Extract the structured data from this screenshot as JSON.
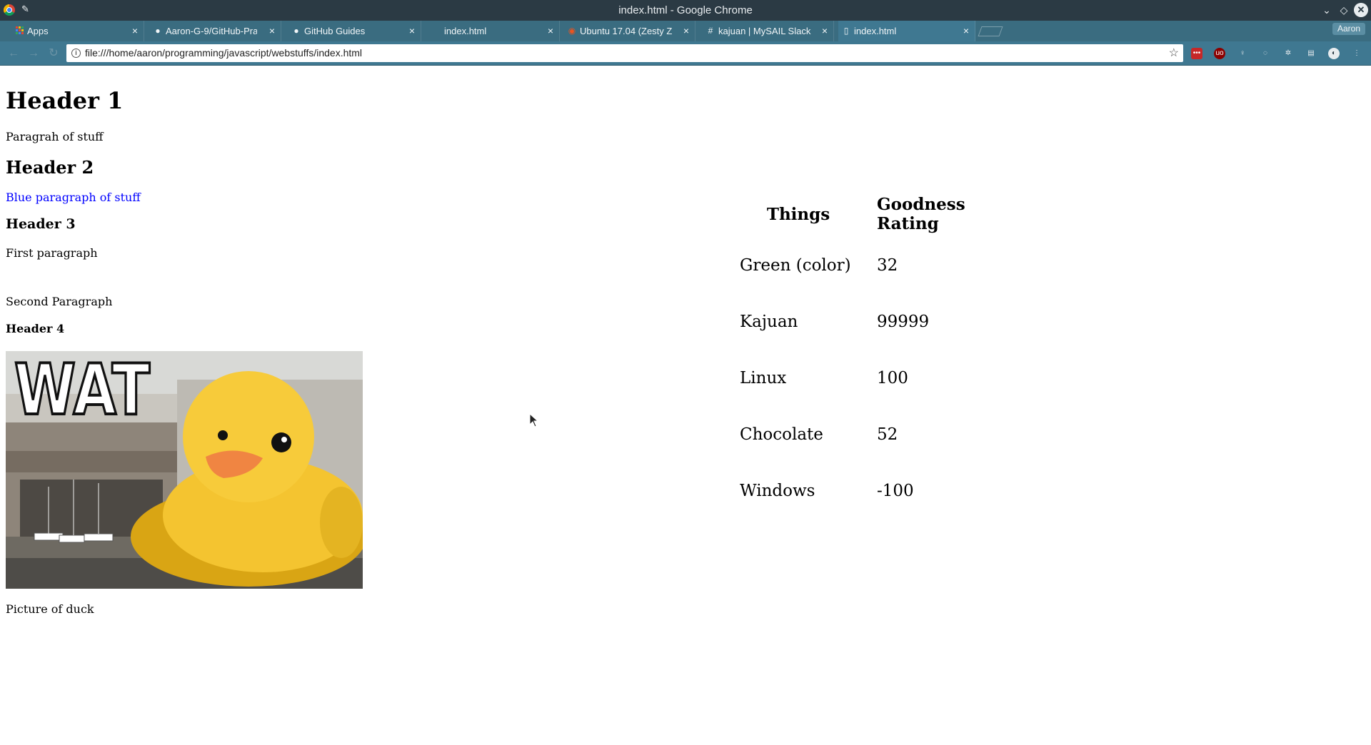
{
  "window": {
    "title": "index.html - Google Chrome"
  },
  "tabs": [
    {
      "label": "Apps",
      "icon": "apps-grid-icon"
    },
    {
      "label": "Aaron-G-9/GitHub-Pra",
      "icon": "github-icon"
    },
    {
      "label": "GitHub Guides",
      "icon": "github-icon"
    },
    {
      "label": "index.html",
      "icon": "page-icon"
    },
    {
      "label": "Ubuntu 17.04 (Zesty Z",
      "icon": "ubuntu-icon"
    },
    {
      "label": "kajuan | MySAIL Slack",
      "icon": "slack-icon"
    },
    {
      "label": "index.html",
      "icon": "page-icon",
      "active": true
    }
  ],
  "profile": {
    "name": "Aaron"
  },
  "omnibox": {
    "url": "file:///home/aaron/programming/javascript/webstuffs/index.html"
  },
  "page": {
    "header1": "Header 1",
    "paragraph1": "Paragrah of stuff",
    "header2": "Header 2",
    "paragraph2": "Blue paragraph of stuff",
    "paragraph2_color": "#0000ff",
    "header3": "Header 3",
    "paragraph3": "First paragraph",
    "paragraph4": "Second Paragraph",
    "header4": "Header 4",
    "image": {
      "overlay_text": "WAT"
    },
    "caption": "Picture of duck"
  },
  "table": {
    "headers": [
      "Things",
      "Goodness Rating"
    ],
    "rows": [
      {
        "thing": "Green (color)",
        "rating": "32"
      },
      {
        "thing": "Kajuan",
        "rating": "99999"
      },
      {
        "thing": "Linux",
        "rating": "100"
      },
      {
        "thing": "Chocolate",
        "rating": "52"
      },
      {
        "thing": "Windows",
        "rating": "-100"
      }
    ]
  },
  "colors": {
    "titlebar": "#2b3a44",
    "tabstrip": "#3a6c80",
    "toolbar": "#3f7891",
    "link_blue": "#0000ff"
  }
}
